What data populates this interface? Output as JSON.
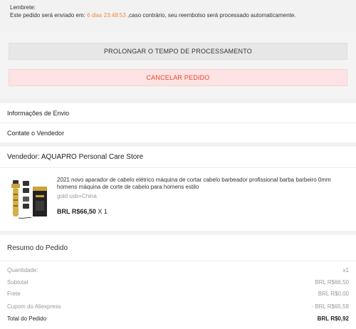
{
  "reminder": {
    "title": "Lembrete:",
    "prefix": "Este pedido será enviado em: ",
    "countdown": "6 dias 23:48:53",
    "suffix": " ,caso contrário, seu reembolso será processado automaticamente."
  },
  "actions": {
    "extend_label": "PROLONGAR O TEMPO DE PROCESSAMENTO",
    "cancel_label": "CANCELAR PEDIDO"
  },
  "links": {
    "shipping": "Informações de Envio",
    "contact": "Contate o Vendedor"
  },
  "store": {
    "name": "Vendedor: AQUAPRO Personal Care Store",
    "product": {
      "title": "2021 novo aparador de cabelo elétrico máquina de cortar cabelo barbeador profissional barba barbeiro 0mm homens máquina de corte de cabelo para homens estilo",
      "variant": "gold usb+China",
      "price": "BRL R$66,50",
      "quantity": "X 1"
    }
  },
  "summary": {
    "title": "Resumo do Pedido",
    "rows": [
      {
        "label": "Quantidade:",
        "value": "x1"
      },
      {
        "label": "Subtotal",
        "value": "BRL R$66,50"
      },
      {
        "label": "Frete",
        "value": "BRL R$0,00"
      },
      {
        "label": "Cupom do Aliexpress",
        "value": "- BRL R$65,58"
      },
      {
        "label": "Total do Pedido",
        "value": "BRL R$0,92"
      }
    ]
  },
  "colors": {
    "countdown": "#f0883b",
    "cancel_text": "#e6452f",
    "cancel_bg": "#fde3e3"
  }
}
